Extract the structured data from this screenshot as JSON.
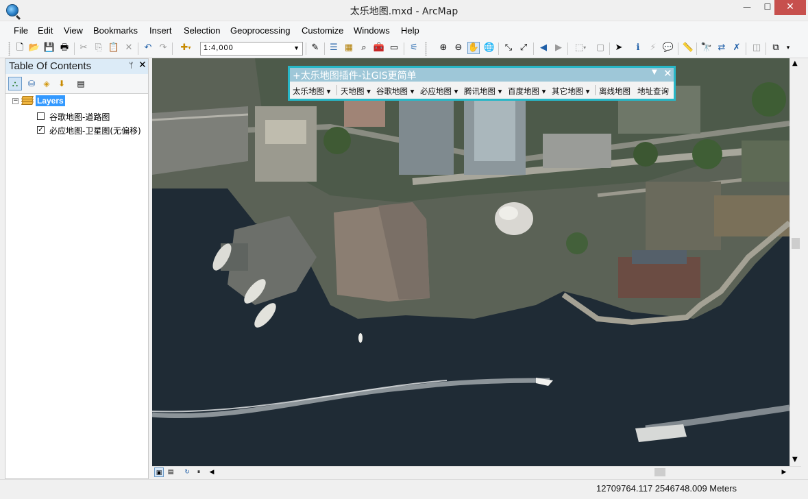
{
  "window": {
    "title": "太乐地图.mxd - ArcMap",
    "minimize": "—",
    "maximize": "☐",
    "close": "✕"
  },
  "menu": [
    "File",
    "Edit",
    "View",
    "Bookmarks",
    "Insert",
    "Selection",
    "Geoprocessing",
    "Customize",
    "Windows",
    "Help"
  ],
  "toolbar": {
    "scale": "1:4,000",
    "tools": [
      {
        "icon": "new-document-icon",
        "glyph": "🗋"
      },
      {
        "icon": "open-folder-icon",
        "glyph": "📂"
      },
      {
        "icon": "save-icon",
        "glyph": "💾"
      },
      {
        "icon": "print-icon",
        "glyph": "🖶"
      },
      {
        "icon": "cut-icon",
        "glyph": "✂"
      },
      {
        "icon": "copy-icon",
        "glyph": "⎘"
      },
      {
        "icon": "paste-icon",
        "glyph": "📋"
      },
      {
        "icon": "delete-icon",
        "glyph": "✕"
      },
      {
        "icon": "undo-icon",
        "glyph": "↶"
      },
      {
        "icon": "redo-icon",
        "glyph": "↷"
      },
      {
        "icon": "add-data-icon",
        "glyph": "✚"
      },
      {
        "icon": "editor-toolbar-icon",
        "glyph": "✎"
      },
      {
        "icon": "table-of-contents-icon",
        "glyph": "☰"
      },
      {
        "icon": "catalog-icon",
        "glyph": "▦"
      },
      {
        "icon": "search-window-icon",
        "glyph": "⌕"
      },
      {
        "icon": "arctoolbox-icon",
        "glyph": "🧰"
      },
      {
        "icon": "python-window-icon",
        "glyph": "▭"
      },
      {
        "icon": "model-builder-icon",
        "glyph": "⚟"
      },
      {
        "icon": "zoom-in-icon",
        "glyph": "⊕"
      },
      {
        "icon": "zoom-out-icon",
        "glyph": "⊖"
      },
      {
        "icon": "pan-hand-icon",
        "glyph": "✋"
      },
      {
        "icon": "full-extent-globe-icon",
        "glyph": "🌐"
      },
      {
        "icon": "fixed-zoom-in-icon",
        "glyph": "⤡"
      },
      {
        "icon": "fixed-zoom-out-icon",
        "glyph": "⤢"
      },
      {
        "icon": "back-extent-icon",
        "glyph": "◀"
      },
      {
        "icon": "forward-extent-icon",
        "glyph": "▶"
      },
      {
        "icon": "select-features-icon",
        "glyph": "⬚"
      },
      {
        "icon": "clear-selection-icon",
        "glyph": "▢"
      },
      {
        "icon": "select-elements-icon",
        "glyph": "➤"
      },
      {
        "icon": "identify-icon",
        "glyph": "ℹ"
      },
      {
        "icon": "hyperlink-icon",
        "glyph": "⚡"
      },
      {
        "icon": "html-popup-icon",
        "glyph": "💬"
      },
      {
        "icon": "measure-icon",
        "glyph": "📏"
      },
      {
        "icon": "find-binoculars-icon",
        "glyph": "🔭"
      },
      {
        "icon": "find-route-icon",
        "glyph": "⇄"
      },
      {
        "icon": "go-to-xy-icon",
        "glyph": "✗"
      },
      {
        "icon": "time-slider-icon",
        "glyph": "◫"
      },
      {
        "icon": "create-viewer-icon",
        "glyph": "⧉"
      }
    ]
  },
  "toc": {
    "title": "Table Of Contents",
    "pin": "ᛘ",
    "close": "✕",
    "root": "Layers",
    "layers": [
      {
        "name": "谷歌地图-道路图",
        "checked": false
      },
      {
        "name": "必应地图-卫星图(无偏移)",
        "checked": true
      }
    ]
  },
  "plugin": {
    "title": "+太乐地图插件-让GIS更简单",
    "items": [
      "太乐地图 ▾",
      "天地图 ▾",
      "谷歌地图 ▾",
      "必应地图 ▾",
      "腾讯地图 ▾",
      "百度地图 ▾",
      "其它地图 ▾",
      "离线地图",
      "地址查询"
    ]
  },
  "status": {
    "coordinates": "12709764.117  2546748.009 Meters"
  },
  "colors": {
    "water": "#1f2b35",
    "plugin_border": "#28b7c7",
    "selection": "#3399ff"
  }
}
